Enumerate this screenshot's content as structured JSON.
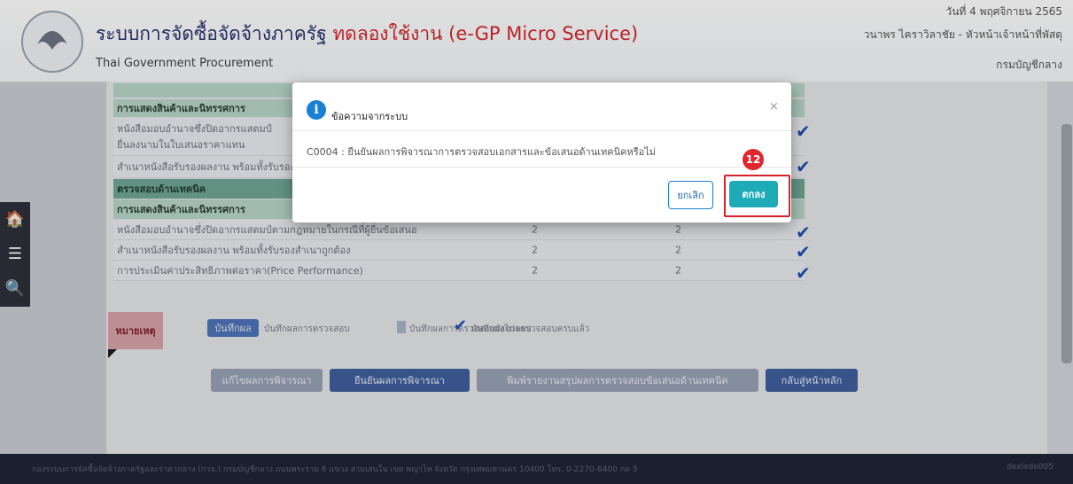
{
  "header": {
    "system_title": "ระบบการจัดซื้อจัดจ้างภาครัฐ",
    "test_label": "ทดลองใช้งาน (e-GP Micro Service)",
    "subtitle": "Thai Government Procurement",
    "date": "วันที่ 4 พฤศจิกายน 2565",
    "user": "วนาพร ไคราวิลาชัย - หัวหน้าเจ้าหน้าที่พัสดุ",
    "department": "กรมบัญชีกลาง"
  },
  "sidebar": {
    "icons": [
      "home-icon",
      "menu-icon",
      "search-icon"
    ],
    "home": "🏠",
    "menu": "☰",
    "search": "🔍"
  },
  "table": {
    "section_doc_group": "การแสดงสินค้าและนิทรรศการ",
    "rows_top": [
      {
        "label": "หนังสือมอบอำนาจซึ่งปิดอากรแสตมป์",
        "label2": "ยื่นลงนามในใบเสนอราคาแทน"
      },
      {
        "label": "สำเนาหนังสือรับรองผลงาน พร้อมทั้งรับรองสำเนาถูกต้อง"
      }
    ],
    "section_tech": "ตรวจสอบด้านเทคนิค",
    "section_tech_group": "การแสดงสินค้าและนิทรรศการ",
    "rows_tech": [
      {
        "label": "หนังสือมอบอำนาจซึ่งปิดอากรแสตมป์ตามกฎหมายในกรณีที่ผู้ยื่นข้อเสนอ",
        "v1": "2",
        "v2": "2"
      },
      {
        "label": "สำเนาหนังสือรับรองผลงาน พร้อมทั้งรับรองสำเนาถูกต้อง",
        "v1": "2",
        "v2": "2"
      },
      {
        "label": "การประเมินค่าประสิทธิภาพต่อราคา(Price Performance)",
        "v1": "2",
        "v2": "2"
      }
    ],
    "check": "✔"
  },
  "legend": {
    "note": "หมายเหตุ",
    "save_btn": "บันทึกผล",
    "text1": "บันทึกผลการตรวจสอบ",
    "text2": "บันทึกผลการตรวจสอบยังไม่ครบ",
    "text3": "บันทึกผลการตรวจสอบครบแล้ว"
  },
  "actions": {
    "edit": "แก้ไขผลการพิจารณา",
    "confirm": "ยืนยันผลการพิจารณา",
    "print": "พิมพ์รายงานสรุปผลการตรวจสอบข้อเสนอด้านเทคนิค",
    "back": "กลับสู่หน้าหลัก"
  },
  "footer": {
    "address": "กองระบบการจัดซื้อจัดจ้างภาครัฐและราคากลาง (กวจ.) กรมบัญชีกลาง ถนนพระราม 6 แขวง สามเสนใน เขต พญาไท จังหวัด กรุงเทพมหานคร 10400 โทร. 0-2270-6400 กด 5",
    "code": "dexlxde005"
  },
  "dialog": {
    "title": "ข้อความจากระบบ",
    "message": "C0004 : ยืนยันผลการพิจารณาการตรวจสอบเอกสารและข้อเสนอด้านเทคนิคหรือไม่",
    "cancel": "ยกเลิก",
    "ok": "ตกลง",
    "close": "×",
    "info_glyph": "i"
  },
  "annotation": {
    "step": "12",
    "accent": "#d8222a"
  }
}
